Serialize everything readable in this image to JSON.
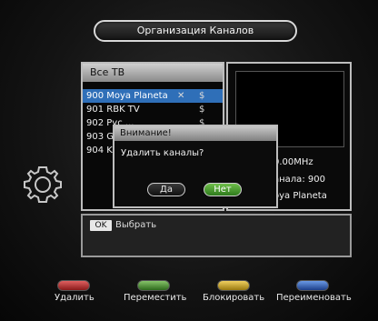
{
  "title": "Организация Каналов",
  "list": {
    "header": "Все ТВ",
    "rows": [
      {
        "label": "900 Moya Planeta",
        "mark": "✕",
        "symbol": "$",
        "selected": true
      },
      {
        "label": "901 RBK TV",
        "symbol": "$"
      },
      {
        "label": "902 Pyc ...",
        "symbol": "$"
      },
      {
        "label": "903 G"
      },
      {
        "label": "904 K"
      }
    ]
  },
  "info": {
    "freq": "0.00MHz",
    "channel": "анала: 900",
    "name": "oya Planeta"
  },
  "dialog": {
    "title": "Внимание!",
    "message": "Удалить каналы?",
    "yes": "Да",
    "no": "Нет"
  },
  "hint": {
    "key": "OK",
    "label": "Выбрать"
  },
  "fkeys": [
    {
      "label": "Удалить",
      "color": "#c83838"
    },
    {
      "label": "Переместить",
      "color": "#4a9a34"
    },
    {
      "label": "Блокировать",
      "color": "#d7b22c"
    },
    {
      "label": "Переименовать",
      "color": "#3d6fc7"
    }
  ]
}
